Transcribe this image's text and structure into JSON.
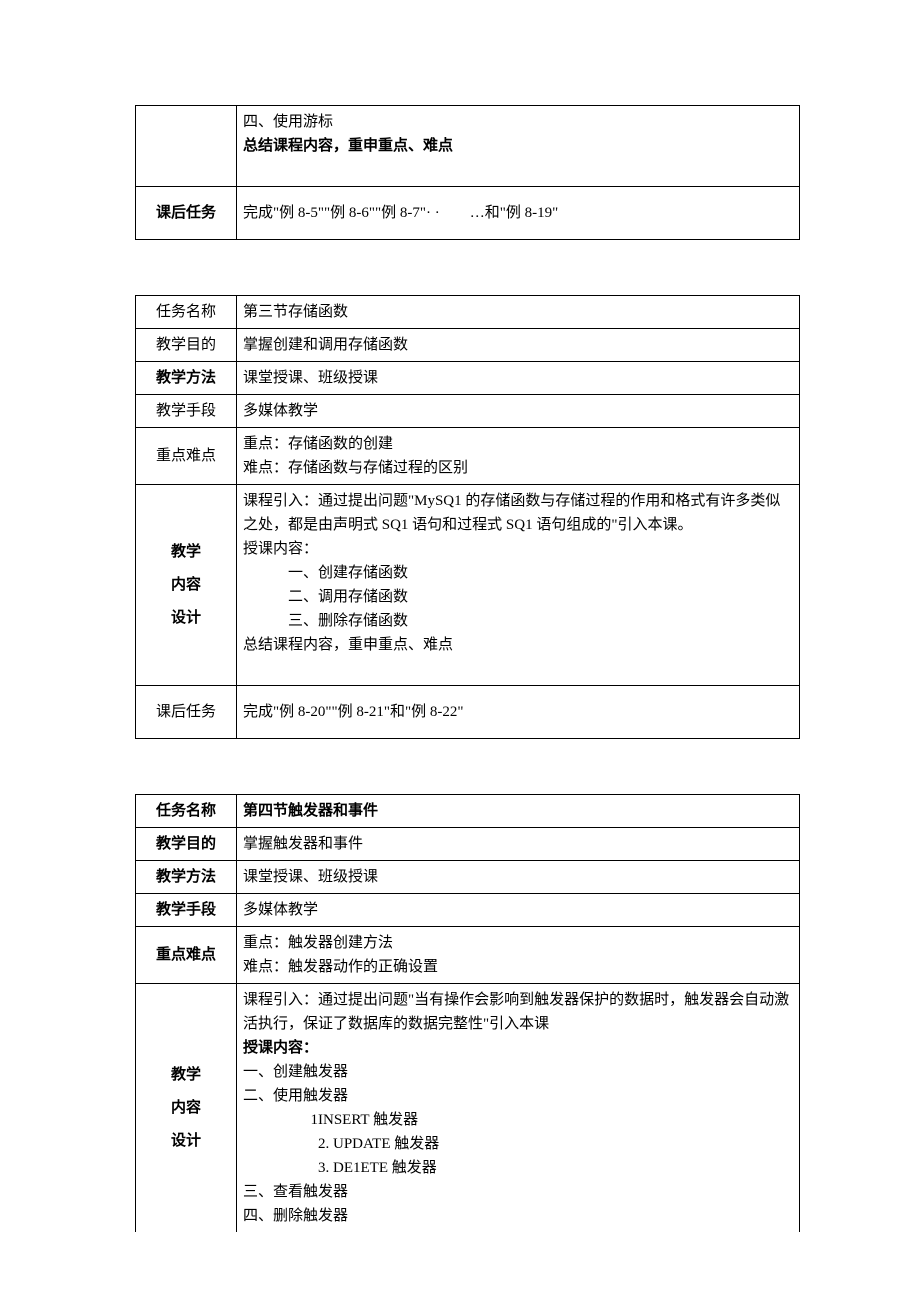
{
  "table1": {
    "row1": {
      "line1": "四、使用游标",
      "line2": "总结课程内容，重申重点、难点"
    },
    "row2": {
      "label": "课后任务",
      "content": "完成\"例 8-5\"\"例 8-6\"\"例 8-7\"· ·　　…和\"例 8-19\""
    }
  },
  "table2": {
    "r1": {
      "label": "任务名称",
      "content": "第三节存储函数"
    },
    "r2": {
      "label": "教学目的",
      "content": "掌握创建和调用存储函数"
    },
    "r3": {
      "label": "教学方法",
      "content": "课堂授课、班级授课"
    },
    "r4": {
      "label": "教学手段",
      "content": "多媒体教学"
    },
    "r5": {
      "label": "重点难点",
      "line1": "重点：存储函数的创建",
      "line2": "难点：存储函数与存储过程的区别"
    },
    "r6": {
      "label1": "教学",
      "label2": "内容",
      "label3": "设计",
      "l1": "课程引入：通过提出问题\"MySQ1 的存储函数与存储过程的作用和格式有许多类似之处，都是由声明式 SQ1 语句和过程式 SQ1 语句组成的\"引入本课。",
      "l2": "授课内容：",
      "l3": "一、创建存储函数",
      "l4": "二、调用存储函数",
      "l5": "三、删除存储函数",
      "l6": "总结课程内容，重申重点、难点"
    },
    "r7": {
      "label": "课后任务",
      "content": "完成\"例 8-20\"\"例 8-21\"和\"例 8-22\""
    }
  },
  "table3": {
    "r1": {
      "label": "任务名称",
      "content": "第四节触发器和事件"
    },
    "r2": {
      "label": "教学目的",
      "content": "掌握触发器和事件"
    },
    "r3": {
      "label": "教学方法",
      "content": "课堂授课、班级授课"
    },
    "r4": {
      "label": "教学手段",
      "content": "多媒体教学"
    },
    "r5": {
      "label": "重点难点",
      "line1": "重点：触发器创建方法",
      "line2": "难点：触发器动作的正确设置"
    },
    "r6": {
      "label1": "教学",
      "label2": "内容",
      "label3": "设计",
      "l1": "课程引入：通过提出问题\"当有操作会影响到触发器保护的数据时，触发器会自动激活执行，保证了数据库的数据完整性\"引入本课",
      "l2": "授课内容：",
      "l3": "一、创建触发器",
      "l4": "二、使用触发器",
      "l5": "1INSERT 触发器",
      "l6": "2.  UPDATE 触发器",
      "l7": "3.  DE1ETE 触发器",
      "l8": "三、查看触发器",
      "l9": "四、删除触发器"
    }
  }
}
